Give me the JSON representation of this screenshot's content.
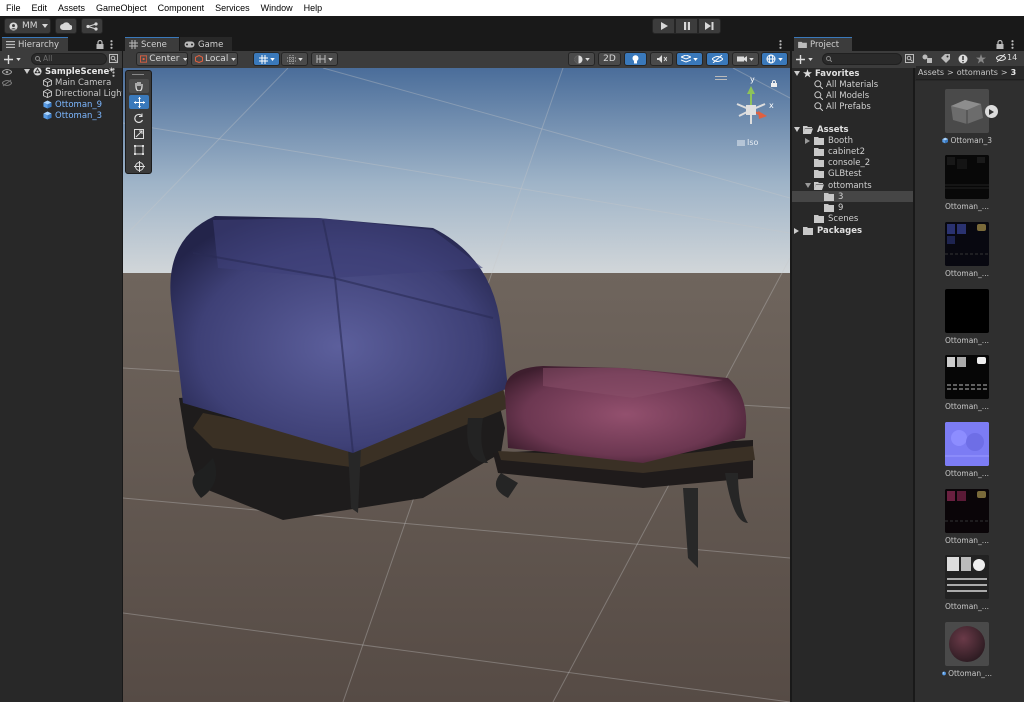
{
  "menu": [
    "File",
    "Edit",
    "Assets",
    "GameObject",
    "Component",
    "Services",
    "Window",
    "Help"
  ],
  "toolbar": {
    "account_label": "MM",
    "play_icon": "play-icon",
    "pause_icon": "pause-icon",
    "step_icon": "step-icon"
  },
  "hierarchy": {
    "tab_label": "Hierarchy",
    "search_placeholder": "All",
    "scene_name": "SampleScene*",
    "items": [
      {
        "label": "Main Camera",
        "highlight": false
      },
      {
        "label": "Directional Light",
        "highlight": false
      },
      {
        "label": "Ottoman_9",
        "highlight": true
      },
      {
        "label": "Ottoman_3",
        "highlight": true
      }
    ]
  },
  "scene": {
    "tabs": [
      "Scene",
      "Game"
    ],
    "pivot_label": "Center",
    "space_label": "Local",
    "mode_2d_label": "2D",
    "iso_label": "Iso",
    "gizmo_y_label": "y",
    "gizmo_x_label": "x"
  },
  "project": {
    "tab_label": "Project",
    "count_label": "14",
    "breadcrumb_root": "Assets",
    "breadcrumb_folder": "ottomants",
    "breadcrumb_current": "3",
    "favorites_label": "Favorites",
    "favorites": [
      "All Materials",
      "All Models",
      "All Prefabs"
    ],
    "assets_label": "Assets",
    "folders": [
      "Booth",
      "cabinet2",
      "console_2",
      "GLBtest",
      "ottomants"
    ],
    "subfolders": [
      "3",
      "9"
    ],
    "scenes_label": "Scenes",
    "packages_label": "Packages",
    "asset_items": [
      {
        "label": "Ottoman_3",
        "kind": "model"
      },
      {
        "label": "Ottoman_...",
        "kind": "tex-dark"
      },
      {
        "label": "Ottoman_...",
        "kind": "tex-blue"
      },
      {
        "label": "Ottoman_...",
        "kind": "tex-black"
      },
      {
        "label": "Ottoman_...",
        "kind": "tex-white"
      },
      {
        "label": "Ottoman_...",
        "kind": "tex-normal"
      },
      {
        "label": "Ottoman_...",
        "kind": "tex-red"
      },
      {
        "label": "Ottoman_...",
        "kind": "tex-gray"
      },
      {
        "label": "Ottoman_...",
        "kind": "material"
      }
    ]
  },
  "colors": {
    "selection_blue": "#3a79bb",
    "hierarchy_highlight": "#7cb7ff",
    "sky_top": "#5a7fae",
    "ground": "#5b514a"
  }
}
